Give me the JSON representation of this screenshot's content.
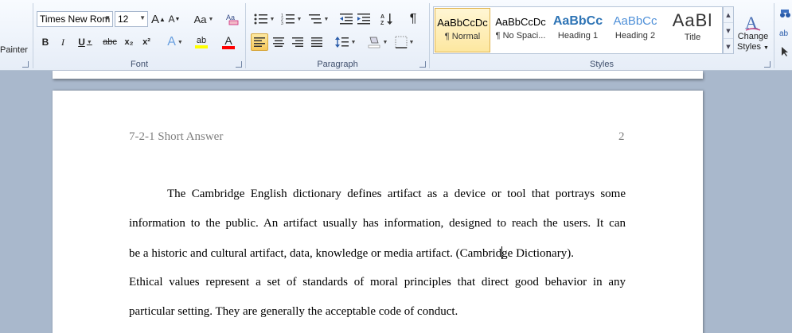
{
  "ribbon": {
    "clipboard": {
      "format_painter_partial": "Painter"
    },
    "font": {
      "font_name": "Times New Rom",
      "font_size": "12",
      "grow_label": "A",
      "shrink_label": "A",
      "change_case_label": "Aa",
      "bold": "B",
      "italic": "I",
      "underline": "U",
      "strike": "abc",
      "subscript": "x₂",
      "superscript": "x²",
      "text_effects": "A",
      "highlight": "ab",
      "font_color": "A",
      "group_label": "Font"
    },
    "paragraph": {
      "group_label": "Paragraph",
      "pilcrow": "¶"
    },
    "styles": {
      "group_label": "Styles",
      "tiles": [
        {
          "sample": "AaBbCcDc",
          "name": "¶ Normal",
          "selected": true
        },
        {
          "sample": "AaBbCcDc",
          "name": "¶ No Spaci...",
          "selected": false
        },
        {
          "sample": "AaBbCc",
          "name": "Heading 1",
          "selected": false
        },
        {
          "sample": "AaBbCc",
          "name": "Heading 2",
          "selected": false
        },
        {
          "sample": "AaBl",
          "name": "Title",
          "selected": false
        }
      ],
      "change_styles_line1": "Change",
      "change_styles_line2": "Styles"
    },
    "colors": {
      "highlight_bar": "#ffff00",
      "font_color_bar": "#ff0000",
      "heading_blue": "#2e74b5"
    }
  },
  "document": {
    "header_title": "7-2-1 Short Answer",
    "page_number": "2",
    "lines": [
      "The Cambridge English dictionary defines artifact as a device or tool that portrays some",
      "information to the public. An artifact usually has information, designed to reach the users. It can",
      "be a historic and cultural artifact, data, knowledge or media artifact. (Cambridge Dictionary).",
      "Ethical values represent a set of standards of moral principles that direct good behavior in any",
      "particular setting. They are generally the acceptable code of conduct."
    ],
    "line3_before_cursor": "be a historic and cultural artifact, data, knowledge or media artifact. (Cambrid",
    "line3_after_cursor": "ge Dictionary)."
  }
}
